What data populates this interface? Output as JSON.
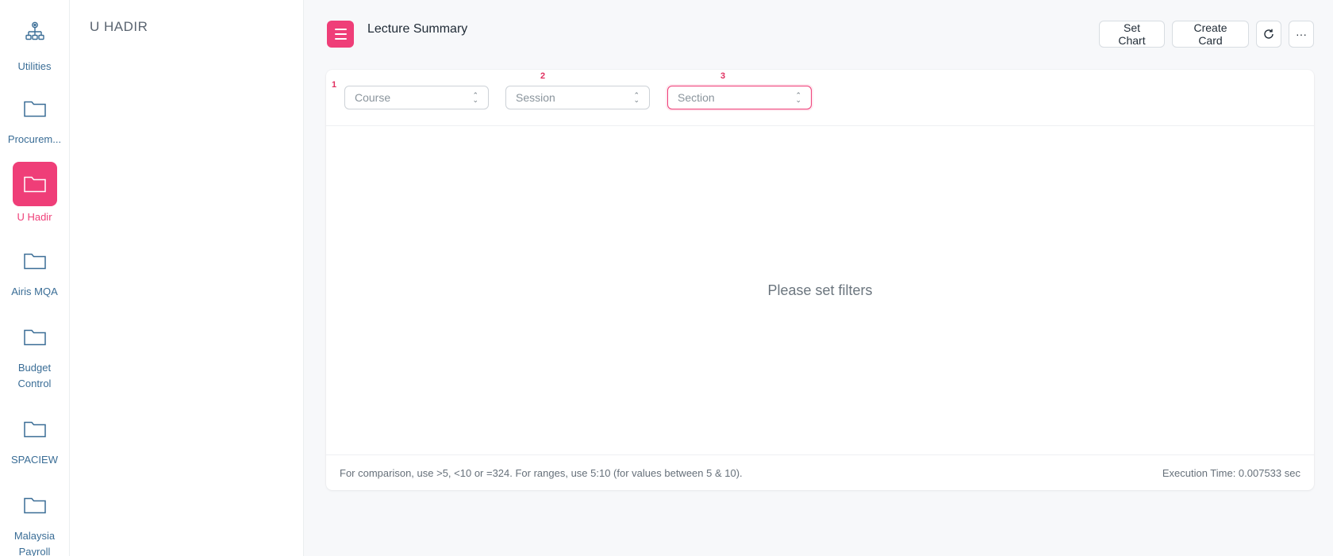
{
  "rail": {
    "items": [
      {
        "label": "Utilities",
        "icon": "org-chart-icon"
      },
      {
        "label": "Procurem...",
        "icon": "folder-icon"
      },
      {
        "label": "U Hadir",
        "icon": "folder-icon",
        "active": true
      },
      {
        "label": "Airis MQA",
        "icon": "folder-icon"
      },
      {
        "label": "Budget\nControl",
        "icon": "folder-icon"
      },
      {
        "label": "SPACIEW",
        "icon": "folder-icon"
      },
      {
        "label": "Malaysia\nPayroll",
        "icon": "folder-icon"
      }
    ]
  },
  "subpanel": {
    "title": "U HADIR"
  },
  "header": {
    "title": "Lecture Summary",
    "actions": {
      "set_chart": "Set Chart",
      "create_card": "Create Card",
      "more": "···"
    }
  },
  "filters": [
    {
      "number": "1",
      "placeholder": "Course"
    },
    {
      "number": "2",
      "placeholder": "Session"
    },
    {
      "number": "3",
      "placeholder": "Section"
    }
  ],
  "content": {
    "empty_message": "Please set filters"
  },
  "footer": {
    "hint": "For comparison, use >5, <10 or =324. For ranges, use 5:10 (for values between 5 & 10).",
    "execution_time": "Execution Time: 0.007533 sec"
  },
  "colors": {
    "accent": "#ef3e78",
    "rail_text": "#3a6d96"
  }
}
